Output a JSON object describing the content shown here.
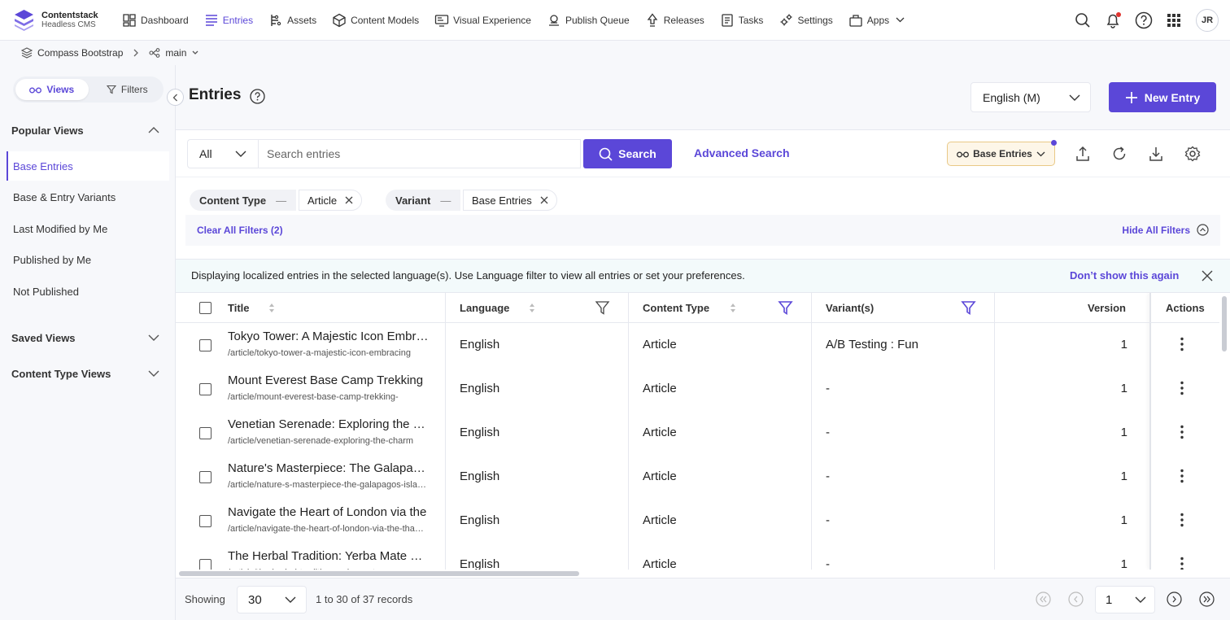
{
  "brand": {
    "name": "Contentstack",
    "sub": "Headless CMS"
  },
  "nav": [
    {
      "label": "Dashboard",
      "icon": "dashboard-icon"
    },
    {
      "label": "Entries",
      "icon": "entries-icon",
      "active": true
    },
    {
      "label": "Assets",
      "icon": "assets-icon"
    },
    {
      "label": "Content Models",
      "icon": "content-models-icon"
    },
    {
      "label": "Visual Experience",
      "icon": "visual-experience-icon"
    },
    {
      "label": "Publish Queue",
      "icon": "publish-queue-icon"
    },
    {
      "label": "Releases",
      "icon": "releases-icon"
    },
    {
      "label": "Tasks",
      "icon": "tasks-icon"
    },
    {
      "label": "Settings",
      "icon": "settings-icon"
    },
    {
      "label": "Apps",
      "icon": "apps-icon"
    }
  ],
  "user": {
    "initials": "JR"
  },
  "breadcrumb": {
    "stack": "Compass Bootstrap",
    "branch": "main"
  },
  "sidebar": {
    "tabs": {
      "views": "Views",
      "filters": "Filters"
    },
    "popular_title": "Popular Views",
    "popular_items": [
      "Base Entries",
      "Base & Entry Variants",
      "Last Modified by Me",
      "Published by Me",
      "Not Published"
    ],
    "saved_title": "Saved Views",
    "content_type_title": "Content Type Views"
  },
  "header": {
    "title": "Entries",
    "language": "English (M)",
    "new_entry": "New Entry"
  },
  "search": {
    "scope": "All",
    "placeholder": "Search entries",
    "button": "Search",
    "advanced": "Advanced Search",
    "view_chip": "Base Entries"
  },
  "filters": {
    "content_type_label": "Content Type",
    "content_type_value": "Article",
    "variant_label": "Variant",
    "variant_value": "Base Entries",
    "clear": "Clear All Filters (2)",
    "hide": "Hide All Filters"
  },
  "notice": {
    "text": "Displaying localized entries in the selected language(s). Use Language filter to view all entries or set your preferences.",
    "dismiss": "Don’t show this again"
  },
  "table": {
    "columns": {
      "title": "Title",
      "language": "Language",
      "content_type": "Content Type",
      "variants": "Variant(s)",
      "version": "Version",
      "actions": "Actions"
    },
    "rows": [
      {
        "title": "Tokyo Tower: A Majestic Icon Embracing",
        "url": "/article/tokyo-tower-a-majestic-icon-embracing",
        "language": "English",
        "content_type": "Article",
        "variants": "A/B Testing : Fun",
        "version": "1"
      },
      {
        "title": "Mount Everest Base Camp Trekking",
        "url": "/article/mount-everest-base-camp-trekking-",
        "language": "English",
        "content_type": "Article",
        "variants": "-",
        "version": "1"
      },
      {
        "title": "Venetian Serenade: Exploring the Charm",
        "url": "/article/venetian-serenade-exploring-the-charm",
        "language": "English",
        "content_type": "Article",
        "variants": "-",
        "version": "1"
      },
      {
        "title": "Nature's Masterpiece: The Galapagos",
        "url": "/article/nature-s-masterpiece-the-galapagos-islands",
        "language": "English",
        "content_type": "Article",
        "variants": "-",
        "version": "1"
      },
      {
        "title": "Navigate the Heart of London via the",
        "url": "/article/navigate-the-heart-of-london-via-the-thames",
        "language": "English",
        "content_type": "Article",
        "variants": "-",
        "version": "1"
      },
      {
        "title": "The Herbal Tradition: Yerba Mate Culture",
        "url": "/article/the-herbal-tradition-yerba-mate",
        "language": "English",
        "content_type": "Article",
        "variants": "-",
        "version": "1"
      }
    ]
  },
  "footer": {
    "showing": "Showing",
    "per_page": "30",
    "records": "1 to 30 of 37 records",
    "page": "1"
  },
  "colors": {
    "accent": "#5b47d8",
    "chip_bg": "#fdf6e8",
    "notice_bg": "#f3fafb"
  }
}
